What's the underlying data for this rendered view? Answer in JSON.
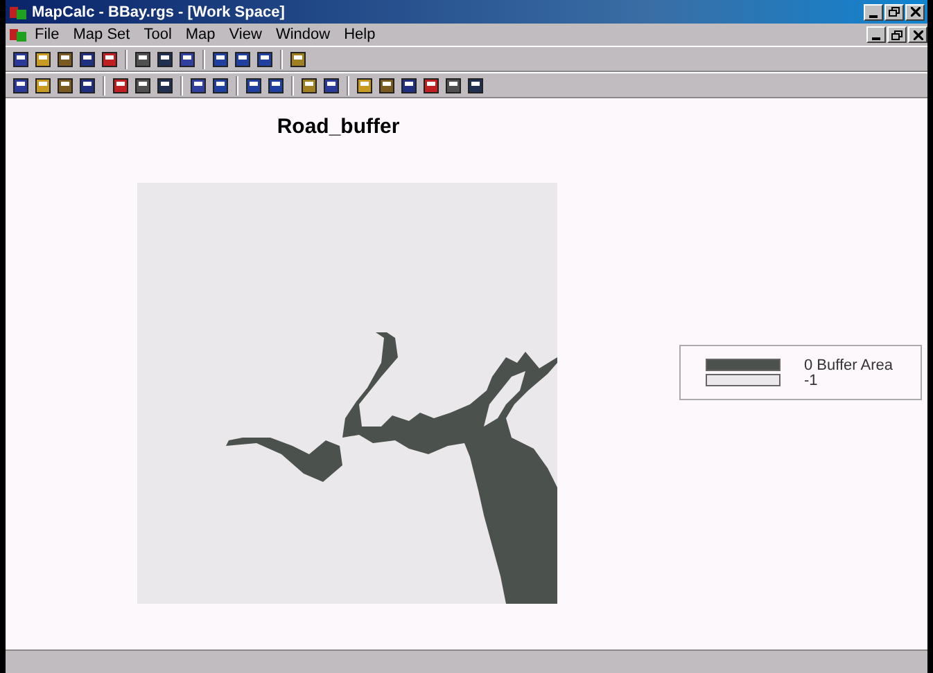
{
  "window": {
    "title": "MapCalc - BBay.rgs - [Work Space]"
  },
  "menu": [
    "File",
    "Map Set",
    "Tool",
    "Map",
    "View",
    "Window",
    "Help"
  ],
  "map": {
    "title": "Road_buffer"
  },
  "legend": [
    {
      "label": "0 Buffer Area",
      "color": "#4b524d"
    },
    {
      "label": "-1",
      "color": "#ebe8eb"
    }
  ]
}
